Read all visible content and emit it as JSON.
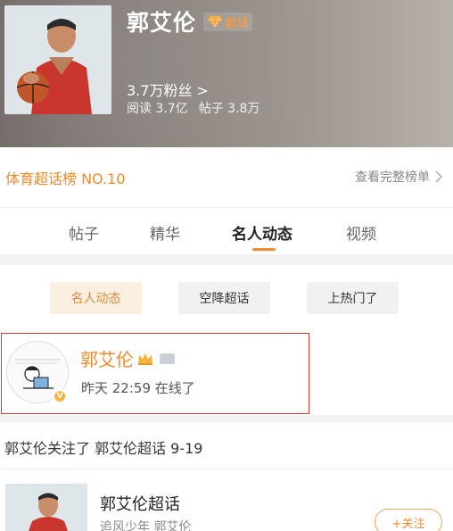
{
  "header": {
    "title": "郭艾伦",
    "badge": "超话",
    "fans": "3.7万粉丝 >",
    "reads": "阅读 3.7亿",
    "posts": "帖子 3.8万"
  },
  "ranking": {
    "label": "体育超话榜 NO.10",
    "view_full": "查看完整榜单"
  },
  "tabs": [
    {
      "label": "帖子",
      "active": false
    },
    {
      "label": "精华",
      "active": false
    },
    {
      "label": "名人动态",
      "active": true
    },
    {
      "label": "视频",
      "active": false
    }
  ],
  "filters": [
    {
      "label": "名人动态",
      "active": true
    },
    {
      "label": "空降超话",
      "active": false
    },
    {
      "label": "上热门了",
      "active": false
    }
  ],
  "celebrity": {
    "name": "郭艾伦",
    "verified": "V",
    "last_online": "昨天 22:59 在线了"
  },
  "activity": {
    "text": "郭艾伦关注了 郭艾伦超话 9-19"
  },
  "topic": {
    "name": "郭艾伦超话",
    "subtitle": "追风少年 郭艾伦",
    "follow": "+关注"
  },
  "colors": {
    "accent": "#f08a2c",
    "highlight_border": "#d33b3b"
  }
}
